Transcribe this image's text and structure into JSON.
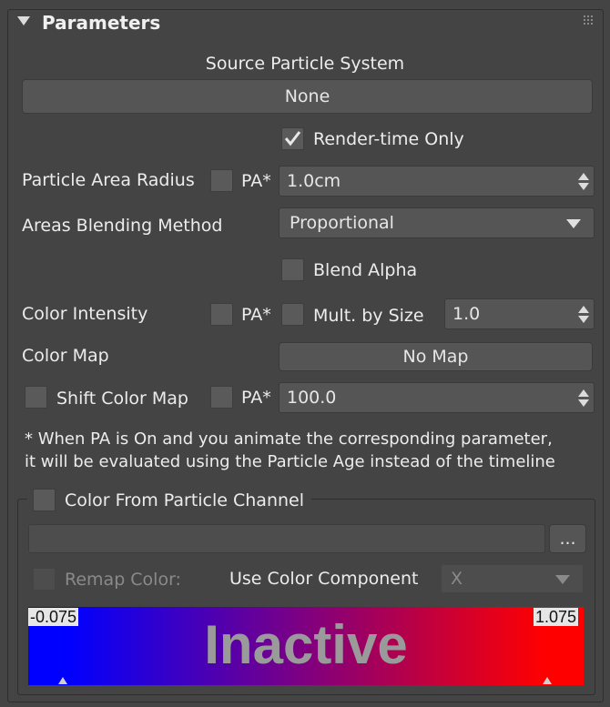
{
  "panel": {
    "title": "Parameters"
  },
  "source": {
    "label": "Source Particle System",
    "button": "None"
  },
  "render_time_only": {
    "label": "Render-time Only",
    "checked": true
  },
  "particle_area_radius": {
    "label": "Particle Area Radius",
    "pa_label": "PA*",
    "value": "1.0cm"
  },
  "areas_blending": {
    "label": "Areas Blending Method",
    "selected": "Proportional"
  },
  "blend_alpha": {
    "label": "Blend Alpha"
  },
  "color_intensity": {
    "label": "Color Intensity",
    "pa_label": "PA*",
    "mult_label": "Mult. by Size",
    "value": "1.0"
  },
  "color_map": {
    "label": "Color Map",
    "button": "No Map"
  },
  "shift_color_map": {
    "label": "Shift Color Map",
    "pa_label": "PA*",
    "value": "100.0"
  },
  "note": {
    "line1": "* When PA is On and you animate the corresponding parameter,",
    "line2": "it will be evaluated using the Particle Age instead of the timeline"
  },
  "channel_group": {
    "label": "Color From Particle Channel",
    "browse_button": "...",
    "remap_label": "Remap Color:",
    "component_label": "Use Color Component",
    "component_value": "X",
    "gradient": {
      "min": "-0.075",
      "max": "1.075",
      "status": "Inactive",
      "color_start": "#0000ff",
      "color_end": "#ff0000"
    }
  },
  "colors": {
    "panel_bg": "#444444",
    "control_bg": "#555555",
    "text": "#e6e6e6"
  }
}
